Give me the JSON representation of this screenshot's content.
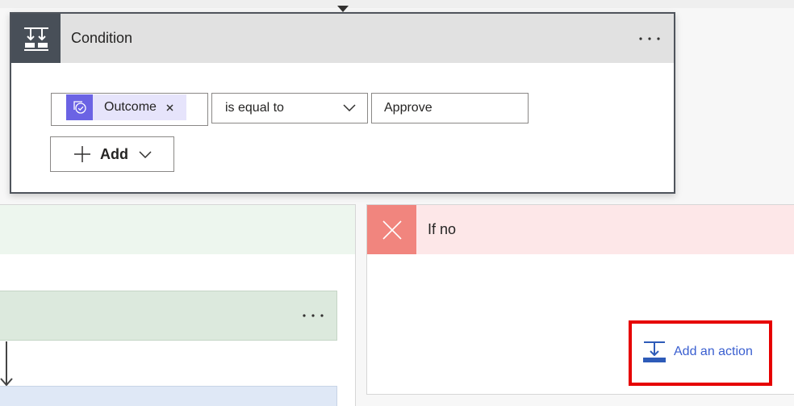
{
  "canvas": {
    "connector_icon": "arrow-down-triangle-icon"
  },
  "condition": {
    "icon": "condition-icon",
    "title": "Condition",
    "more_icon": "more-options-icon",
    "row": {
      "token": {
        "icon": "approvals-icon",
        "label": "Outcome",
        "remove_icon": "close-icon"
      },
      "operator": {
        "selected": "is equal to",
        "icon": "chevron-down-icon"
      },
      "value": "Approve"
    },
    "add_button": {
      "label": "Add",
      "icon": "plus-icon",
      "menu_icon": "chevron-down-icon"
    }
  },
  "branches": {
    "yes": {
      "action_card": {
        "more_icon": "more-options-icon"
      },
      "connector_icon": "arrow-down-icon"
    },
    "no": {
      "icon": "close-icon",
      "title": "If no",
      "add_action": {
        "icon": "add-action-icon",
        "label": "Add an action"
      }
    }
  },
  "colors": {
    "condition_border": "#4f545c",
    "condition_header_bg": "#e1e1e1",
    "condition_icon_bg": "#484f58",
    "token_bg": "#e6e4fb",
    "token_icon_bg": "#6b63e4",
    "yes_header_bg": "#edf6ee",
    "yes_action_bg": "#dce9dd",
    "no_header_bg": "#fde7e8",
    "no_icon_bg": "#f1857e",
    "link": "#3a5fd0",
    "highlight": "#e60000"
  }
}
